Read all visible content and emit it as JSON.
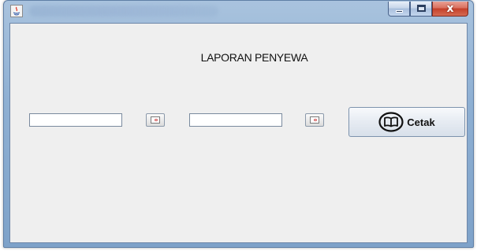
{
  "window": {
    "title_visible": false,
    "controls": [
      "minimize",
      "maximize",
      "close"
    ],
    "close_glyph": "x"
  },
  "report": {
    "heading": "LAPORAN PENYEWA"
  },
  "date_from": {
    "value": ""
  },
  "date_to": {
    "value": ""
  },
  "print_button": {
    "label": "Cetak",
    "icon": "book-icon"
  },
  "colors": {
    "frame": "#8fb0d3",
    "panel": "#efefef",
    "close": "#c4402a"
  }
}
